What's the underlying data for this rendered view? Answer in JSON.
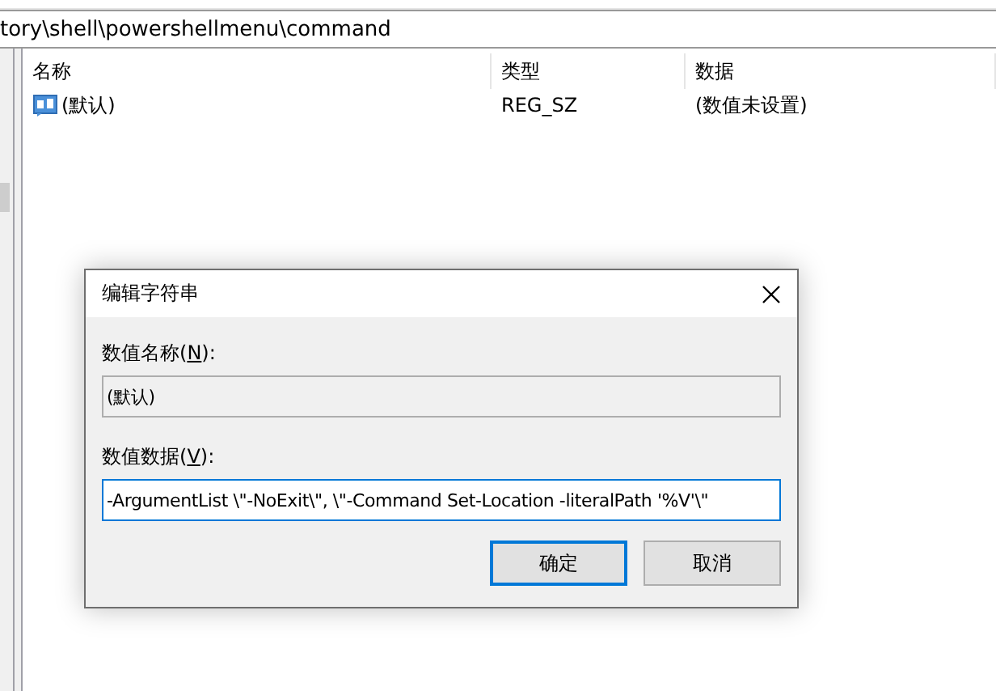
{
  "address_bar": {
    "path": "tory\\shell\\powershellmenu\\command"
  },
  "table": {
    "columns": [
      "名称",
      "类型",
      "数据"
    ],
    "rows": [
      {
        "name": "(默认)",
        "type": "REG_SZ",
        "data": "(数值未设置)",
        "selected": false
      }
    ]
  },
  "dialog": {
    "title": "编辑字符串",
    "fields": [
      {
        "label_before": "数值名称(",
        "mnemonic": "N",
        "label_after": "):",
        "value": "(默认)",
        "disabled": true,
        "focused": false
      },
      {
        "label_before": "数值数据(",
        "mnemonic": "V",
        "label_after": "):",
        "value": "-ArgumentList \\\"-NoExit\\\", \\\"-Command Set-Location -literalPath '%V'\\\"",
        "disabled": false,
        "focused": true
      }
    ],
    "buttons": [
      {
        "label": "确定",
        "default": true
      },
      {
        "label": "取消",
        "default": false
      }
    ]
  }
}
